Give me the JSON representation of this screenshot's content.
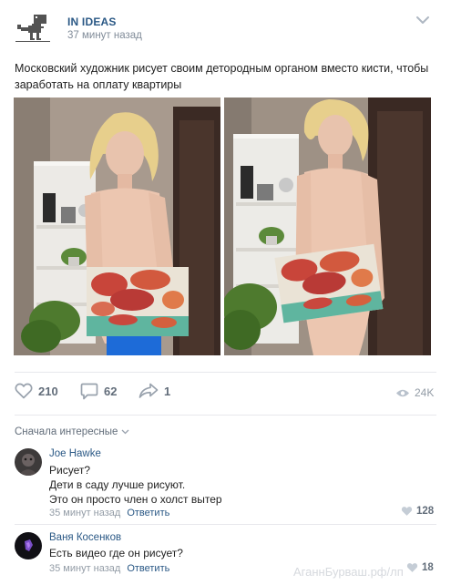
{
  "post": {
    "group_name": "IN IDEAS",
    "time": "37 минут назад",
    "text": "Московский художник рисует своим детородным органом вместо кисти, чтобы заработать на оплату квартиры"
  },
  "actions": {
    "likes": "210",
    "comments": "62",
    "shares": "1",
    "views": "24K"
  },
  "comments_section": {
    "sort_label": "Сначала интересные"
  },
  "comments": [
    {
      "author": "Joe Hawke",
      "text": "Рисует?\nДети в саду лучше рисуют.\nЭто он просто член о холст вытер",
      "time": "35 минут назад",
      "reply_label": "Ответить",
      "likes": "128"
    },
    {
      "author": "Ваня Косенков",
      "text": "Есть видео где он рисует?",
      "time": "35 минут назад",
      "reply_label": "Ответить",
      "likes": "18"
    }
  ],
  "watermark": "АганнБурваш.рф/лп",
  "colors": {
    "link": "#2a5885",
    "muted": "#818c99",
    "icon": "#99a2ad"
  }
}
